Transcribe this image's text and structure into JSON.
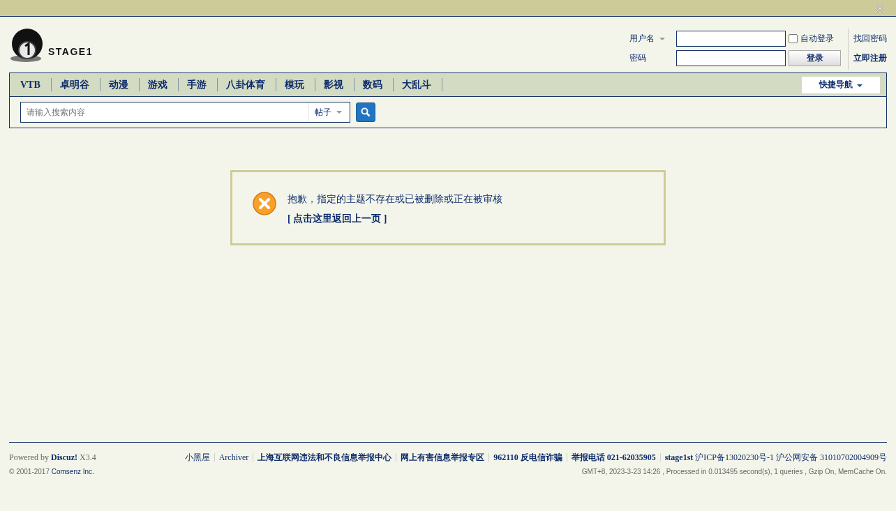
{
  "logo": {
    "text": "STAGE1"
  },
  "login": {
    "username_label": "用户名",
    "password_label": "密码",
    "auto_login": {
      "label": "自动登录",
      "checked": false
    },
    "login_button": "登录",
    "links": [
      {
        "label": "找回密码",
        "bold": false
      },
      {
        "label": "立即注册",
        "bold": true
      }
    ]
  },
  "nav": {
    "items": [
      {
        "label": "VTB"
      },
      {
        "label": "卓明谷"
      },
      {
        "label": "动漫"
      },
      {
        "label": "游戏"
      },
      {
        "label": "手游"
      },
      {
        "label": "八卦体育"
      },
      {
        "label": "模玩"
      },
      {
        "label": "影视"
      },
      {
        "label": "数码"
      },
      {
        "label": "大乱斗"
      }
    ],
    "quick_nav": "快捷导航"
  },
  "search": {
    "placeholder": "请输入搜索内容",
    "type": "帖子"
  },
  "message": {
    "text": "抱歉，指定的主题不存在或已被删除或正在被审核",
    "back_link": "[ 点击这里返回上一页 ]"
  },
  "footer": {
    "powered_prefix": "Powered by",
    "powered_link": "Discuz!",
    "version": "X3.4",
    "copyright": "© 2001-2017",
    "company_link": "Comsenz Inc.",
    "links": [
      {
        "text": "小黑屋",
        "bold": false
      },
      {
        "text": "Archiver",
        "bold": false
      },
      {
        "text": "上海互联网违法和不良信息举报中心",
        "bold": true
      },
      {
        "text": "网上有害信息举报专区",
        "bold": true
      },
      {
        "text": "962110 反电信诈骗",
        "bold": true
      },
      {
        "text": "举报电话 021-62035905",
        "bold": true
      },
      {
        "text": "**stage1st** 沪ICP备13020230号-1 沪公网安备 31010702004909号",
        "bold": false
      }
    ],
    "stats": "GMT+8, 2023-3-23 14:26 , Processed in 0.013495 second(s), 1 queries , Gzip On, MemCache On."
  }
}
